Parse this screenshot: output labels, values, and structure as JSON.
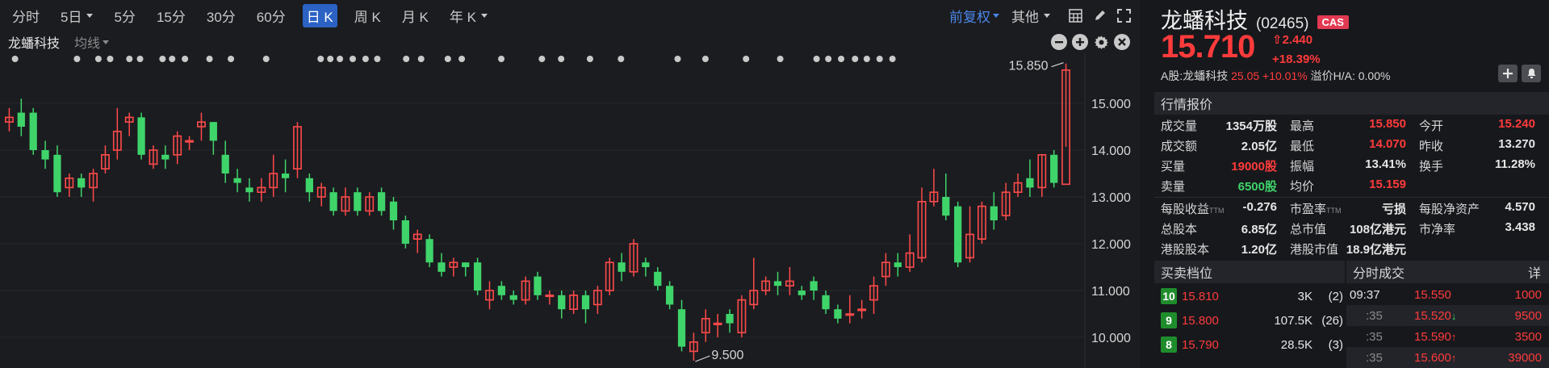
{
  "toolbar": {
    "periods": [
      "分时",
      "5日",
      "5分",
      "15分",
      "30分",
      "60分",
      "日 K",
      "周 K",
      "月 K",
      "年 K"
    ],
    "active": "日 K",
    "adjust": "前复权",
    "more": "其他"
  },
  "chart_header": {
    "name": "龙蟠科技",
    "ma": "均线"
  },
  "chart_data": {
    "type": "candlestick",
    "y_ticks": [
      "15.000",
      "14.000",
      "13.000",
      "12.000",
      "11.000",
      "10.000"
    ],
    "ylim": [
      9.4,
      16.1
    ],
    "high_label": "15.850",
    "low_label": "9.500",
    "colors": {
      "up": "#ff4a4a",
      "down": "#3fd46a"
    },
    "candles": [
      [
        14.6,
        14.7,
        14.9,
        14.4
      ],
      [
        14.8,
        14.5,
        15.1,
        14.3
      ],
      [
        14.8,
        14.0,
        14.9,
        13.9
      ],
      [
        14.0,
        13.8,
        14.2,
        13.6
      ],
      [
        13.9,
        13.1,
        14.1,
        13.0
      ],
      [
        13.2,
        13.4,
        13.5,
        13.0
      ],
      [
        13.4,
        13.2,
        13.5,
        13.0
      ],
      [
        13.2,
        13.5,
        13.6,
        12.9
      ],
      [
        13.6,
        13.9,
        14.1,
        13.5
      ],
      [
        14.0,
        14.4,
        14.9,
        13.8
      ],
      [
        14.6,
        14.7,
        14.8,
        14.3
      ],
      [
        14.7,
        13.9,
        14.8,
        13.8
      ],
      [
        13.7,
        14.0,
        14.1,
        13.6
      ],
      [
        13.9,
        13.8,
        14.1,
        13.6
      ],
      [
        13.9,
        14.3,
        14.4,
        13.7
      ],
      [
        14.2,
        14.2,
        14.3,
        14.0
      ],
      [
        14.5,
        14.6,
        14.8,
        14.2
      ],
      [
        14.6,
        14.2,
        14.6,
        13.9
      ],
      [
        13.9,
        13.5,
        14.2,
        13.3
      ],
      [
        13.4,
        13.3,
        13.6,
        13.1
      ],
      [
        13.2,
        13.1,
        13.4,
        12.9
      ],
      [
        13.1,
        13.2,
        13.4,
        12.9
      ],
      [
        13.2,
        13.5,
        13.9,
        13.0
      ],
      [
        13.5,
        13.4,
        13.8,
        13.1
      ],
      [
        13.6,
        14.5,
        14.6,
        13.4
      ],
      [
        13.4,
        13.1,
        13.5,
        12.9
      ],
      [
        13.0,
        13.2,
        13.3,
        12.8
      ],
      [
        13.1,
        12.7,
        13.2,
        12.6
      ],
      [
        12.7,
        13.0,
        13.2,
        12.6
      ],
      [
        13.1,
        12.7,
        13.2,
        12.6
      ],
      [
        12.7,
        13.0,
        13.1,
        12.6
      ],
      [
        13.1,
        12.7,
        13.2,
        12.6
      ],
      [
        12.9,
        12.5,
        13.0,
        12.3
      ],
      [
        12.5,
        12.0,
        12.6,
        11.9
      ],
      [
        12.1,
        12.2,
        12.3,
        11.8
      ],
      [
        12.1,
        11.6,
        12.2,
        11.5
      ],
      [
        11.6,
        11.4,
        11.8,
        11.3
      ],
      [
        11.5,
        11.6,
        11.7,
        11.3
      ],
      [
        11.6,
        11.5,
        11.6,
        11.3
      ],
      [
        11.6,
        11.0,
        11.7,
        10.9
      ],
      [
        10.8,
        11.0,
        11.2,
        10.6
      ],
      [
        11.1,
        10.9,
        11.2,
        10.8
      ],
      [
        10.9,
        10.8,
        11.0,
        10.7
      ],
      [
        10.8,
        11.2,
        11.3,
        10.7
      ],
      [
        11.3,
        10.9,
        11.4,
        10.8
      ],
      [
        10.9,
        10.9,
        11.0,
        10.7
      ],
      [
        10.9,
        10.6,
        11.0,
        10.4
      ],
      [
        10.6,
        10.9,
        11.0,
        10.5
      ],
      [
        10.9,
        10.6,
        11.0,
        10.3
      ],
      [
        10.7,
        11.0,
        11.1,
        10.5
      ],
      [
        11.0,
        11.6,
        11.7,
        10.9
      ],
      [
        11.6,
        11.4,
        11.8,
        11.2
      ],
      [
        11.4,
        12.0,
        12.1,
        11.3
      ],
      [
        11.6,
        11.5,
        11.7,
        11.3
      ],
      [
        11.4,
        11.1,
        11.5,
        11.0
      ],
      [
        11.1,
        10.7,
        11.2,
        10.6
      ],
      [
        10.6,
        9.8,
        10.8,
        9.7
      ],
      [
        9.7,
        9.9,
        10.1,
        9.5
      ],
      [
        10.1,
        10.4,
        10.6,
        9.9
      ],
      [
        10.3,
        10.3,
        10.5,
        10.0
      ],
      [
        10.5,
        10.3,
        10.6,
        10.1
      ],
      [
        10.1,
        10.8,
        10.9,
        10.0
      ],
      [
        10.7,
        11.0,
        11.7,
        10.6
      ],
      [
        11.0,
        11.2,
        11.3,
        10.9
      ],
      [
        11.2,
        11.1,
        11.4,
        10.9
      ],
      [
        11.1,
        11.2,
        11.5,
        10.9
      ],
      [
        11.0,
        10.9,
        11.1,
        10.8
      ],
      [
        11.2,
        11.0,
        11.3,
        10.8
      ],
      [
        10.9,
        10.6,
        11.0,
        10.5
      ],
      [
        10.6,
        10.4,
        10.7,
        10.3
      ],
      [
        10.5,
        10.5,
        10.9,
        10.3
      ],
      [
        10.6,
        10.6,
        10.8,
        10.4
      ],
      [
        10.8,
        11.1,
        11.3,
        10.5
      ],
      [
        11.3,
        11.6,
        11.8,
        11.1
      ],
      [
        11.6,
        11.5,
        11.8,
        11.3
      ],
      [
        11.5,
        11.8,
        12.2,
        11.4
      ],
      [
        11.7,
        12.9,
        13.2,
        11.6
      ],
      [
        12.9,
        13.1,
        13.6,
        12.8
      ],
      [
        13.0,
        12.6,
        13.5,
        12.5
      ],
      [
        12.8,
        11.6,
        12.9,
        11.5
      ],
      [
        11.7,
        12.2,
        12.8,
        11.6
      ],
      [
        12.1,
        12.8,
        12.9,
        12.0
      ],
      [
        12.8,
        12.5,
        13.1,
        12.3
      ],
      [
        12.6,
        13.1,
        13.3,
        12.5
      ],
      [
        13.1,
        13.3,
        13.5,
        13.0
      ],
      [
        13.4,
        13.2,
        13.8,
        13.0
      ],
      [
        13.2,
        13.9,
        13.9,
        13.0
      ],
      [
        13.9,
        13.3,
        14.0,
        13.2
      ],
      [
        13.27,
        15.71,
        15.85,
        14.07
      ]
    ],
    "top_dots": [
      0.5,
      6.3,
      8.3,
      9.4,
      11.2,
      12.2,
      14.3,
      15.2,
      16.4,
      18.7,
      20.7,
      24.0,
      29.1,
      30.0,
      30.9,
      32.1,
      33.3,
      34.4,
      37.1,
      38.5,
      41.0,
      42.3,
      46.0,
      49.8,
      51.6,
      54.3,
      57.2,
      62.5,
      65.1,
      68.9,
      72.1,
      75.5,
      76.6,
      77.8,
      79.1,
      80.2,
      81.4,
      82.6
    ]
  },
  "quote": {
    "name": "龙蟠科技",
    "code": "(02465)",
    "badge": "CAS",
    "price": "15.710",
    "change": "2.440",
    "pct": "+18.39%",
    "a_share_label": "A股:龙蟠科技",
    "a_share_value": "25.05 +10.01%",
    "premium": "溢价H/A: 0.00%",
    "section_title": "行情报价",
    "stats": [
      [
        [
          "成交量",
          "1354万股",
          ""
        ],
        [
          "最高",
          "15.850",
          "red"
        ],
        [
          "今开",
          "15.240",
          "red"
        ]
      ],
      [
        [
          "成交额",
          "2.05亿",
          ""
        ],
        [
          "最低",
          "14.070",
          "red"
        ],
        [
          "昨收",
          "13.270",
          ""
        ]
      ],
      [
        [
          "买量",
          "19000股",
          "red"
        ],
        [
          "振幅",
          "13.41%",
          ""
        ],
        [
          "换手",
          "11.28%",
          ""
        ]
      ],
      [
        [
          "卖量",
          "6500股",
          "green"
        ],
        [
          "均价",
          "15.159",
          "red"
        ],
        [
          "",
          "",
          ""
        ]
      ]
    ],
    "stats2": [
      [
        [
          "每股收益",
          "TTM",
          "-0.276"
        ],
        [
          "市盈率",
          "TTM",
          "亏损"
        ],
        [
          "每股净资产",
          "",
          "4.570"
        ]
      ],
      [
        [
          "总股本",
          "",
          "6.85亿"
        ],
        [
          "总市值",
          "",
          "108亿港元"
        ],
        [
          "市净率",
          "",
          "3.438"
        ]
      ],
      [
        [
          "港股股本",
          "",
          "1.20亿"
        ],
        [
          "港股市值",
          "",
          "18.9亿港元"
        ],
        [
          "",
          "",
          ""
        ]
      ]
    ]
  },
  "order_book": {
    "title": "买卖档位",
    "rows": [
      {
        "level": "10",
        "price": "15.810",
        "vol": "3K",
        "cnt": "2"
      },
      {
        "level": "9",
        "price": "15.800",
        "vol": "107.5K",
        "cnt": "26"
      },
      {
        "level": "8",
        "price": "15.790",
        "vol": "28.5K",
        "cnt": "3"
      }
    ]
  },
  "ticks": {
    "title": "分时成交",
    "more": "详",
    "rows": [
      {
        "time": "09:37",
        "price": "15.550",
        "arrow": "",
        "vol": "1000"
      },
      {
        "time": ":35",
        "price": "15.520",
        "arrow": "down",
        "vol": "9500"
      },
      {
        "time": ":35",
        "price": "15.590",
        "arrow": "up",
        "vol": "3500"
      },
      {
        "time": ":35",
        "price": "15.600",
        "arrow": "up",
        "vol": "39000"
      }
    ]
  }
}
